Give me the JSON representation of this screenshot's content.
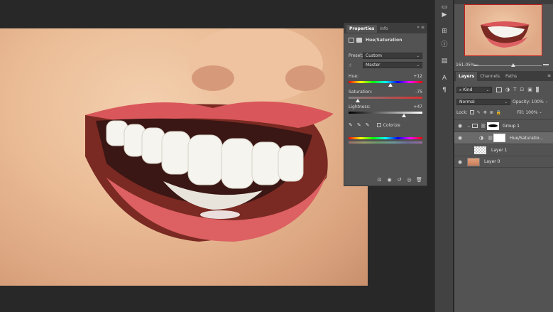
{
  "properties": {
    "tabs": [
      "Properties",
      "Info"
    ],
    "title": "Hue/Saturation",
    "preset_label": "Preset:",
    "preset_value": "Custom",
    "channel_value": "Master",
    "hue": {
      "label": "Hue:",
      "value": "+12",
      "fraction": 0.56
    },
    "saturation": {
      "label": "Saturation:",
      "value": "-75",
      "fraction": 0.12
    },
    "lightness": {
      "label": "Lightness:",
      "value": "+47",
      "fraction": 0.74
    },
    "colorize_label": "Colorize"
  },
  "navigator": {
    "zoom": "161.05%"
  },
  "layers": {
    "tabs": [
      "Layers",
      "Channels",
      "Paths"
    ],
    "filter_value": "Kind",
    "blend_mode": "Normal",
    "opacity_label": "Opacity:",
    "opacity_value": "100%",
    "lock_label": "Lock:",
    "fill_label": "Fill:",
    "fill_value": "100%",
    "items": [
      {
        "name": "Group 1"
      },
      {
        "name": "Hue/Saturatio..."
      },
      {
        "name": "Layer 1"
      },
      {
        "name": "Layer 0"
      }
    ]
  },
  "colors": {
    "accent": "#c32020",
    "panel": "#535353",
    "dark": "#282828"
  }
}
